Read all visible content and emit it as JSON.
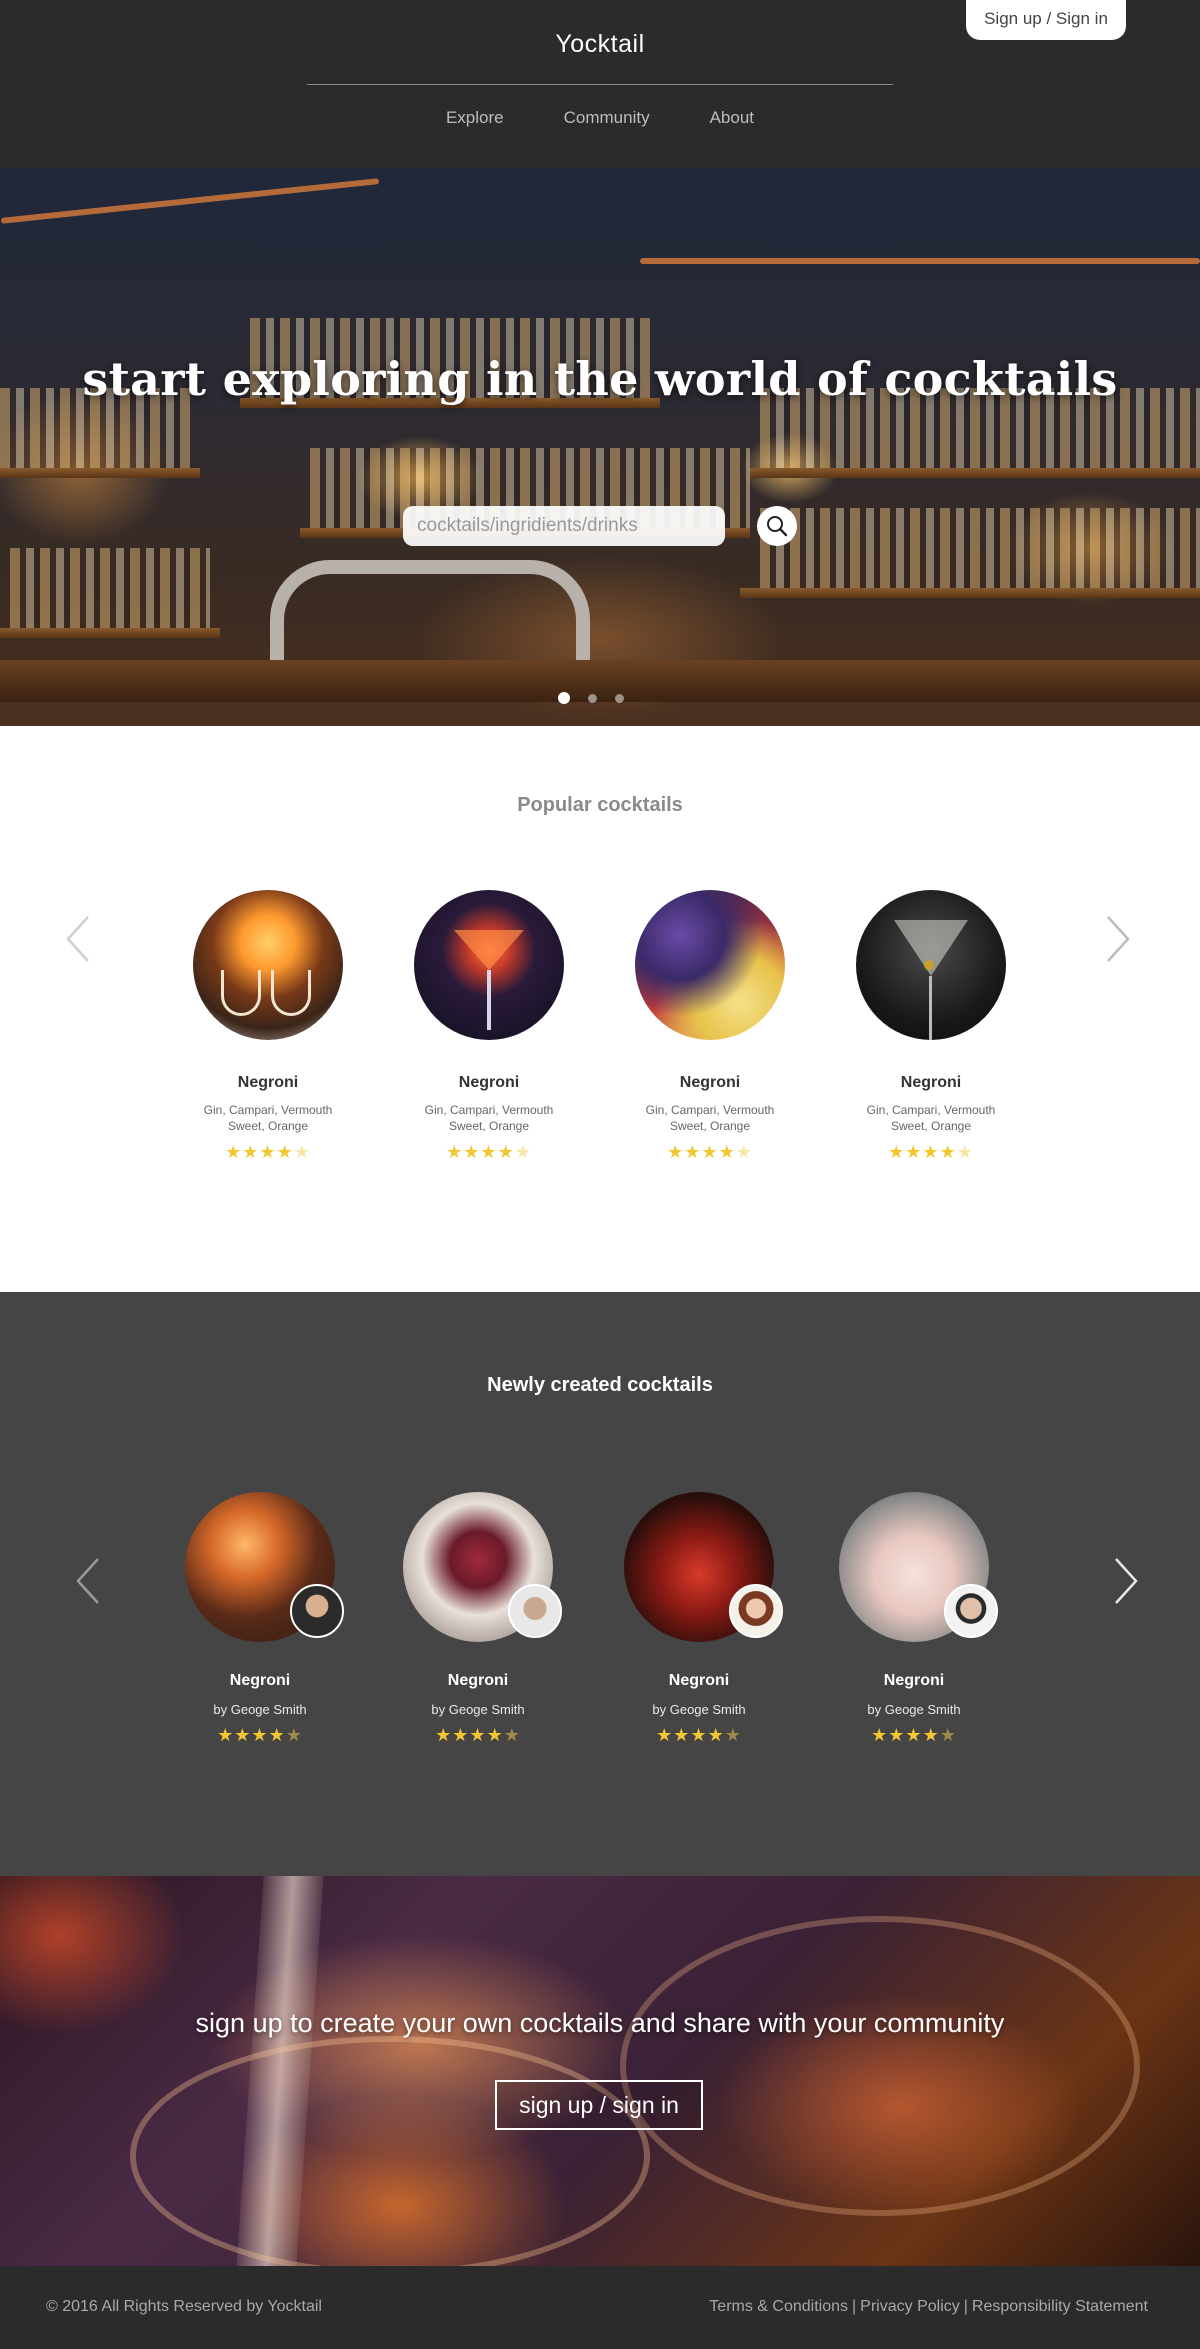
{
  "header": {
    "brand": "Yocktail",
    "nav": [
      "Explore",
      "Community",
      "About"
    ],
    "auth_button": "Sign up / Sign in"
  },
  "hero": {
    "title": "start exploring in the world of cocktails",
    "search_placeholder": "cocktails/ingridients/drinks",
    "search_icon": "search-icon",
    "slides": 3,
    "active_slide": 1
  },
  "popular": {
    "title": "Popular cocktails",
    "items": [
      {
        "name": "Negroni",
        "ingredients": "Gin, Campari, Vermouth Sweet, Orange",
        "rating": 4,
        "max_rating": 5
      },
      {
        "name": "Negroni",
        "ingredients": "Gin, Campari, Vermouth Sweet, Orange",
        "rating": 4,
        "max_rating": 5
      },
      {
        "name": "Negroni",
        "ingredients": "Gin, Campari, Vermouth Sweet, Orange",
        "rating": 4,
        "max_rating": 5
      },
      {
        "name": "Negroni",
        "ingredients": "Gin, Campari, Vermouth Sweet, Orange",
        "rating": 4,
        "max_rating": 5
      }
    ],
    "prev_icon": "chevron-left-icon",
    "next_icon": "chevron-right-icon"
  },
  "newly": {
    "title": "Newly created cocktails",
    "items": [
      {
        "name": "Negroni",
        "author": "by Geoge Smith",
        "rating": 4,
        "max_rating": 5
      },
      {
        "name": "Negroni",
        "author": "by Geoge Smith",
        "rating": 4,
        "max_rating": 5
      },
      {
        "name": "Negroni",
        "author": "by Geoge Smith",
        "rating": 4,
        "max_rating": 5
      },
      {
        "name": "Negroni",
        "author": "by Geoge Smith",
        "rating": 4,
        "max_rating": 5
      }
    ]
  },
  "cta": {
    "text": "sign up to create your own cocktails and share with your community",
    "button": "sign up / sign in"
  },
  "footer": {
    "copyright": "© 2016 All Rights Reserved by Yocktail",
    "links": [
      "Terms & Conditions",
      "Privacy Policy",
      "Responsibility Statement"
    ]
  },
  "colors": {
    "header_bg": "#2b2b2b",
    "section_dark_bg": "#454545",
    "star": "#f4c630"
  }
}
